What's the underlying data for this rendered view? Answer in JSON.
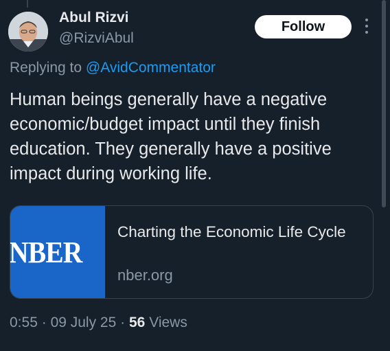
{
  "author": {
    "name": "Abul Rizvi",
    "handle": "@RizviAbul"
  },
  "actions": {
    "follow_label": "Follow",
    "more_icon": "more-vertical-icon"
  },
  "reply": {
    "prefix": "Replying to",
    "mention": "@AvidCommentator"
  },
  "tweet": {
    "text": "Human beings generally have a negative economic/budget impact until they finish education. They generally have a positive impact during working life."
  },
  "card": {
    "logo_text": "NBER",
    "title": "Charting the Economic Life Cycle",
    "domain": "nber.org"
  },
  "meta": {
    "time": "0:55",
    "separator1": "·",
    "date": "09 July 25",
    "separator2": "·",
    "views_count": "56",
    "views_label": "Views"
  },
  "colors": {
    "background": "#15202b",
    "link": "#1d9bf0",
    "card_logo_bg": "#1a66c8"
  }
}
